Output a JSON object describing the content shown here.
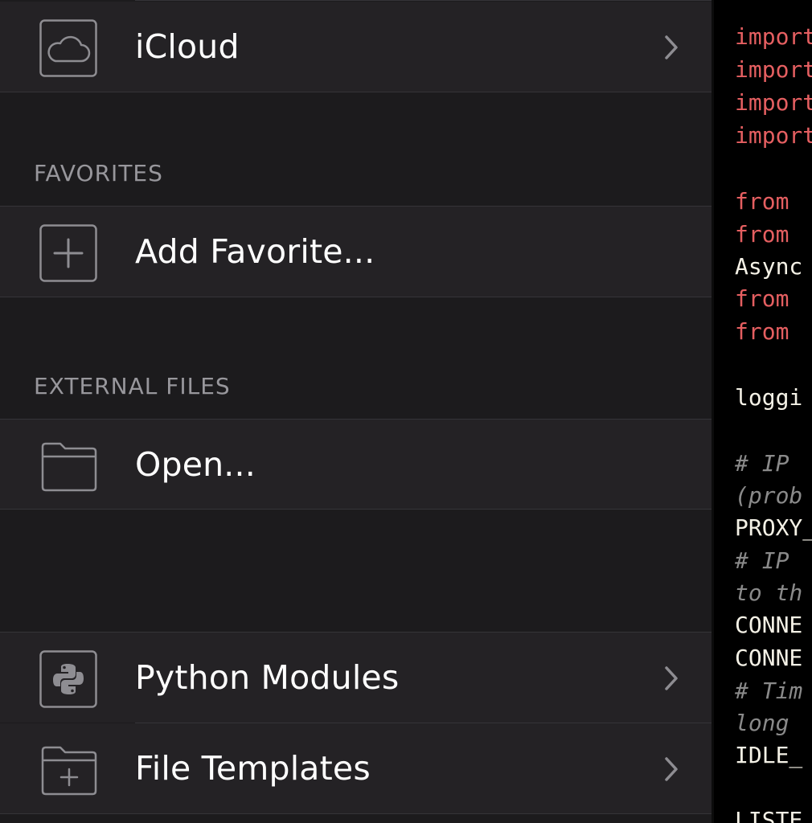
{
  "sidebar": {
    "icloud": {
      "label": "iCloud",
      "icon": "cloud-icon"
    },
    "favorites": {
      "header": "FAVORITES",
      "add_label": "Add Favorite...",
      "icon": "plus-icon"
    },
    "external": {
      "header": "EXTERNAL FILES",
      "open_label": "Open...",
      "icon": "folder-icon"
    },
    "python_modules": {
      "label": "Python Modules",
      "icon": "python-icon"
    },
    "file_templates": {
      "label": "File Templates",
      "icon": "folder-plus-icon"
    }
  },
  "editor": {
    "lines": [
      {
        "text": "import",
        "style": "kw"
      },
      {
        "text": "import",
        "style": "kw"
      },
      {
        "text": "import",
        "style": "kw"
      },
      {
        "text": "import",
        "style": "kw"
      },
      {
        "text": "from",
        "style": "kw"
      },
      {
        "text": "from",
        "style": "kw"
      },
      {
        "text": "Async",
        "style": "plain"
      },
      {
        "text": "from",
        "style": "kw"
      },
      {
        "text": "from",
        "style": "kw"
      },
      {
        "text": "loggi",
        "style": "plain"
      },
      {
        "text": "# IP",
        "style": "cmt"
      },
      {
        "text": "(prob",
        "style": "cmt"
      },
      {
        "text": "PROXY_",
        "style": "plain"
      },
      {
        "text": "# IP",
        "style": "cmt"
      },
      {
        "text": "to th",
        "style": "cmt"
      },
      {
        "text": "CONNE",
        "style": "plain"
      },
      {
        "text": "CONNE",
        "style": "plain"
      },
      {
        "text": "# Tim",
        "style": "cmt"
      },
      {
        "text": "long",
        "style": "cmt"
      },
      {
        "text": "IDLE_",
        "style": "plain"
      },
      {
        "text": "LISTE",
        "style": "plain"
      }
    ]
  },
  "colors": {
    "background": "#1c1b1d",
    "row": "#242225",
    "keyword": "#e55f61",
    "comment": "#8a8a8a",
    "text": "#f4f1e6"
  }
}
